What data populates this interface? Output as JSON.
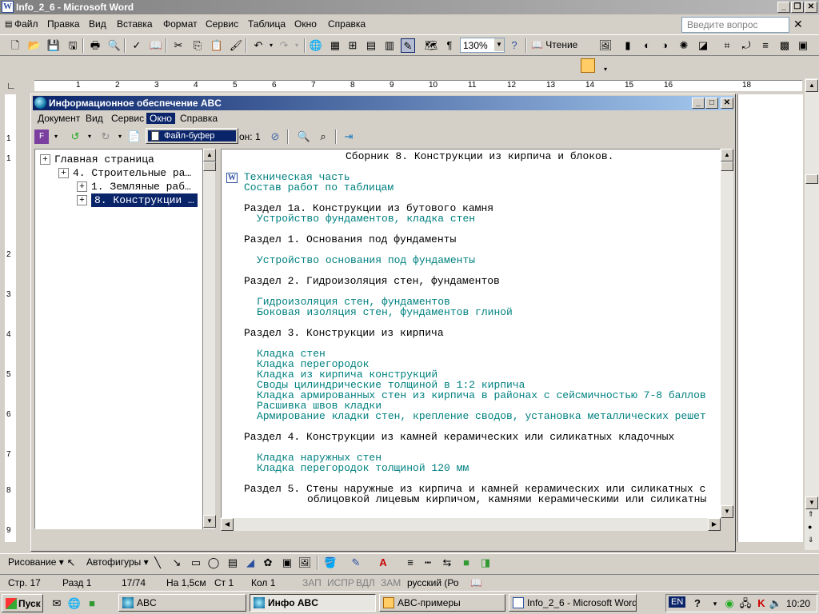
{
  "word": {
    "title": "Info_2_6 - Microsoft Word",
    "menu": [
      "Файл",
      "Правка",
      "Вид",
      "Вставка",
      "Формат",
      "Сервис",
      "Таблица",
      "Окно",
      "Справка"
    ],
    "help_placeholder": "Введите вопрос",
    "zoom": "130%",
    "read_label": "Чтение",
    "ruler_numbers": [
      "1",
      "2",
      "3",
      "4",
      "5",
      "6",
      "7",
      "8",
      "9",
      "10",
      "11",
      "12",
      "13",
      "14",
      "15",
      "16",
      "18"
    ],
    "vruler_numbers": [
      "1",
      "1",
      "2",
      "3",
      "4",
      "5",
      "6",
      "7",
      "8",
      "9"
    ]
  },
  "abc": {
    "title": "Информационное обеспечение ABC",
    "menu": [
      "Документ",
      "Вид",
      "Сервис",
      "Окно",
      "Справка"
    ],
    "dropdown_item": "Файл-буфер",
    "toolbar_fragment": "он: 1",
    "tree": [
      {
        "label": "Главная страница",
        "level": 0
      },
      {
        "label": "4. Строительные ра…",
        "level": 1
      },
      {
        "label": "1. Земляные раб…",
        "level": 2
      },
      {
        "label": "8. Конструкции …",
        "level": 2,
        "selected": true
      }
    ],
    "content": {
      "heading": "Сборник 8. Конструкции из кирпича и блоков.",
      "links_top": [
        "Техническая часть",
        "Состав работ по таблицам"
      ],
      "sections": [
        {
          "title": "Раздел 1а. Конструкции из бутового камня",
          "items": [
            "Устройство фундаментов, кладка стен"
          ],
          "gap": false
        },
        {
          "title": "Раздел 1. Основания под фундаменты",
          "items": [
            "Устройство основания под фундаменты"
          ],
          "gap": true
        },
        {
          "title": "Раздел 2. Гидроизоляция стен, фундаментов",
          "items": [
            "Гидроизоляция стен, фундаментов",
            "Боковая изоляция стен, фундаментов глиной"
          ],
          "gap": true
        },
        {
          "title": "Раздел 3. Конструкции из кирпича",
          "items": [
            "Кладка стен",
            "Кладка перегородок",
            "Кладка из кирпича конструкций",
            "Своды цилиндрические толщиной в 1:2 кирпича",
            "Кладка армированных стен из кирпича в районах с сейсмичностью 7-8 баллов",
            "Расшивка швов кладки",
            "Армирование кладки стен, крепление сводов, установка металлических решет"
          ],
          "gap": true
        },
        {
          "title": "Раздел 4. Конструкции из камней керамических или силикатных кладочных",
          "items": [
            "Кладка наружных стен",
            "Кладка перегородок толщиной 120 мм"
          ],
          "gap": true
        },
        {
          "title": "Раздел 5. Стены наружные из кирпича и камней керамических или силикатных с",
          "title2": "облицовкой лицевым кирпичом, камнями керамическими или силикатны",
          "items": [],
          "gap": false
        }
      ]
    }
  },
  "draw_toolbar": {
    "drawing": "Рисование",
    "autoshapes": "Автофигуры"
  },
  "status": {
    "page": "Стр. 17",
    "section": "Разд 1",
    "pages": "17/74",
    "at": "На 1,5см",
    "line": "Ст 1",
    "col": "Кол 1",
    "rec": "ЗАП",
    "trk": "ИСПР",
    "ext": "ВДЛ",
    "ovr": "ЗАМ",
    "lang": "русский (Ро"
  },
  "taskbar": {
    "start": "Пуск",
    "tasks": [
      "ABC",
      "Инфо ABC",
      "ABC-примеры",
      "Info_2_6 - Microsoft Word"
    ],
    "lang": "EN",
    "clock": "10:20"
  },
  "colors": {
    "link": "#008080",
    "selection": "#0a246a",
    "face": "#d4d0c8"
  }
}
